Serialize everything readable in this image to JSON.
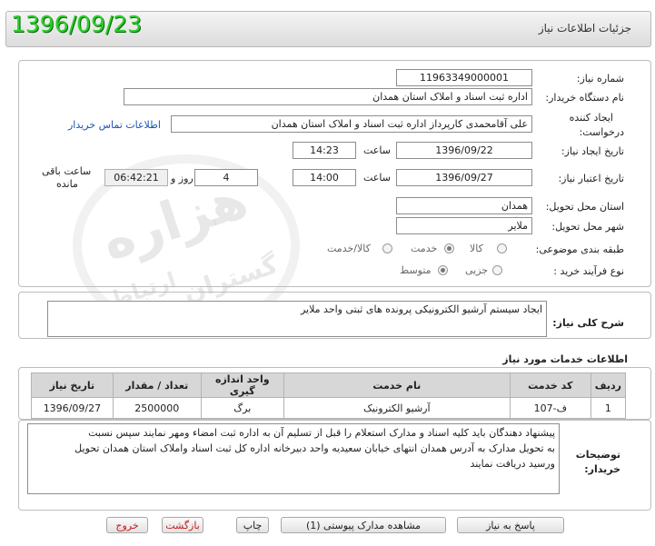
{
  "header": {
    "title": "جزئیات اطلاعات نیاز",
    "date": "1396/09/23"
  },
  "form": {
    "need_number": {
      "label": "شماره نیاز:",
      "value": "11963349000001"
    },
    "buyer_org": {
      "label": "نام دستگاه خریدار:",
      "value": "اداره ثبت اسناد و املاک استان همدان"
    },
    "requester": {
      "label1": "ایجاد کننده",
      "label2": "درخواست:",
      "value": "علی آقامحمدی کارپرداز اداره ثبت اسناد و املاک استان همدان",
      "contact_link": "اطلاعات تماس خریدار"
    },
    "create_date": {
      "label": "تاریخ ایجاد نیاز:",
      "date": "1396/09/22",
      "time_label": "ساعت",
      "time": "14:23"
    },
    "validity": {
      "label": "تاریخ اعتبار نیاز:",
      "date": "1396/09/27",
      "time_label": "ساعت",
      "time": "14:00",
      "days": "4",
      "days_label": "روز و",
      "remaining": "06:42:21",
      "remaining_label1": "ساعت باقی",
      "remaining_label2": "مانده"
    },
    "province": {
      "label": "استان محل تحویل:",
      "value": "همدان"
    },
    "city": {
      "label": "شهر محل تحویل:",
      "value": "ملایر"
    },
    "category": {
      "label": "طبقه بندی موضوعی:",
      "options": [
        "کالا",
        "خدمت",
        "کالا/خدمت"
      ],
      "selected": "خدمت"
    },
    "process": {
      "label": "نوع فرآیند خرید :",
      "options": [
        "جزیی",
        "متوسط"
      ],
      "selected": "متوسط"
    }
  },
  "description": {
    "label": "شرح کلی نیاز:",
    "value": "ایجاد سیستم آرشیو الکترونیکی پرونده های ثبتی واحد ملایر"
  },
  "services": {
    "title": "اطلاعات خدمات مورد نیاز",
    "columns": [
      "ردیف",
      "کد خدمت",
      "نام خدمت",
      "واحد اندازه گیری",
      "تعداد / مقدار",
      "تاریخ نیاز"
    ],
    "rows": [
      [
        "1",
        "ف-107",
        "آرشیو الکترونیک",
        "برگ",
        "2500000",
        "1396/09/27"
      ]
    ]
  },
  "buyer_notes": {
    "label1": "توضیحات",
    "label2": "خریدار:",
    "lines": [
      "پیشنهاد دهندگان باید کلیه اسناد و مدارک استعلام را قبل از تسلیم آن به اداره ثبت امضاء ومهر نمایند  سپس نسبت",
      "به تحویل مدارک به آدرس همدان انتهای خیابان سعیدیه واحد دبیرخانه اداره کل ثبت اسناد واملاک استان همدان تحویل",
      "ورسید دریافت نمایند"
    ]
  },
  "buttons": {
    "reply": "پاسخ به نیاز",
    "attachments": "مشاهده مدارک پیوستی (1)",
    "print": "چاپ",
    "back": "بازگشت",
    "exit": "خروج"
  },
  "watermark": {
    "line1": "هزاره",
    "line2": "گستران",
    "line3": "ارتباط"
  }
}
